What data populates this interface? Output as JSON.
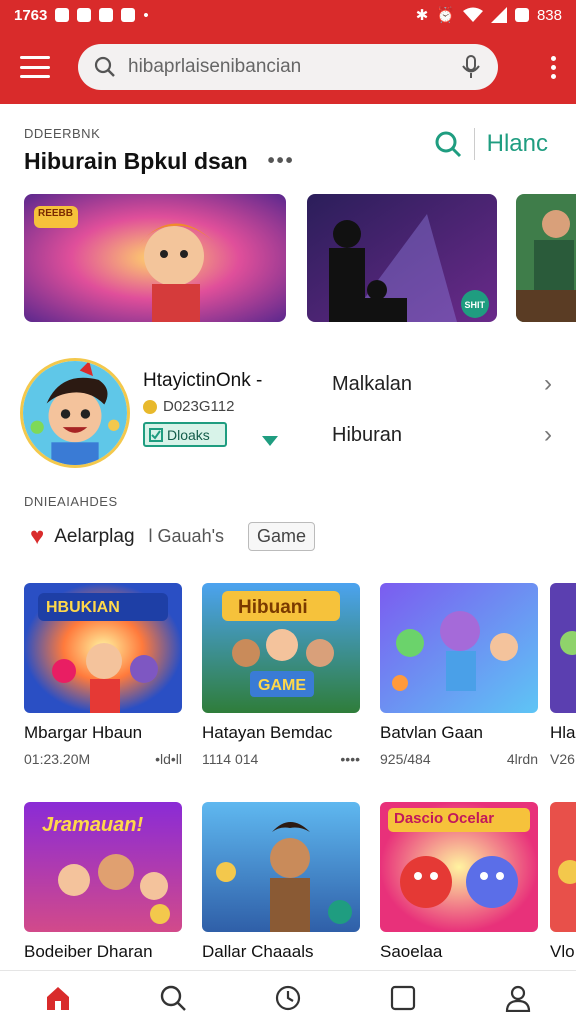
{
  "status_bar": {
    "time": "1763",
    "battery": "838"
  },
  "search": {
    "query": "hibaprlaisenibancian"
  },
  "section": {
    "overline": "DDEERBNK",
    "title": "Hiburain Bpkul dsan",
    "more": "•••",
    "right_label": "Hlanc"
  },
  "banners": [
    {
      "badge": "REEBB"
    },
    {
      "badge": "SHIT"
    },
    {
      "badge": ""
    }
  ],
  "profile": {
    "name": "HtayictinOnk -",
    "coins": "D023G112",
    "badge": "Dloaks"
  },
  "menu": [
    {
      "label": "Malkalan",
      "chevron": "›"
    },
    {
      "label": "Hiburan",
      "chevron": "›"
    }
  ],
  "filters": {
    "overline": "DNIEAIAHDES",
    "primary": "Aelarplag",
    "secondary": "l Gauah's",
    "button": "Game"
  },
  "games_row1": [
    {
      "title": "Mbargar Hbaun",
      "size": "01:23.20M",
      "stat": "•ld•ll",
      "banner": "HBUKIAN"
    },
    {
      "title": "Hatayan Bemdac",
      "size": "1114 014",
      "stat": "••••",
      "banner": "Hibuani",
      "sub": "GAME"
    },
    {
      "title": "Batvlan Gaan",
      "size": "925/484",
      "stat": "4lrdn",
      "banner": ""
    },
    {
      "title": "Hlal",
      "size": "V26",
      "stat": "",
      "banner": ""
    }
  ],
  "games_row2": [
    {
      "title": "Bodeiber Dharan",
      "banner": "Jramauan!"
    },
    {
      "title": "Dallar Chaaals",
      "banner": ""
    },
    {
      "title": "Saoelaa",
      "banner": "Dascio Ocelar"
    },
    {
      "title": "Vlo",
      "banner": ""
    }
  ],
  "colors": {
    "brand": "#d92b2b",
    "accent": "#1f9d80"
  },
  "nav": [
    "home-icon",
    "search-icon",
    "clock-icon",
    "square-icon",
    "profile-icon"
  ]
}
